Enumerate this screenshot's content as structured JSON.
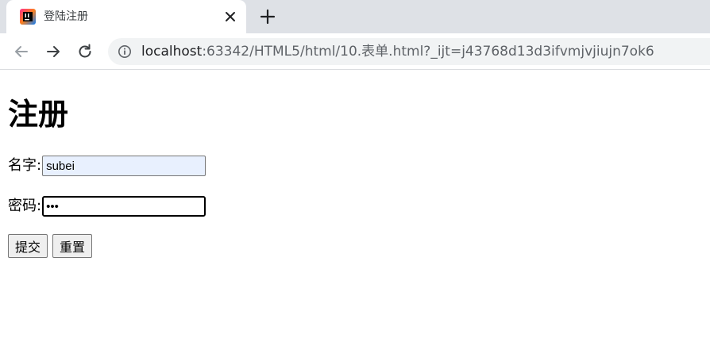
{
  "browser": {
    "tab": {
      "title": "登陆注册",
      "favicon": "jetbrains-favicon-icon"
    },
    "new_tab_icon": "plus-icon",
    "address": {
      "host": "localhost",
      "rest": ":63342/HTML5/html/10.表单.html?_ijt=j43768d13d3ifvmjvjiujn7ok6"
    },
    "nav_icons": [
      "arrow-left-icon",
      "arrow-right-icon",
      "reload-icon",
      "info-icon"
    ]
  },
  "page": {
    "title": "注册",
    "form": {
      "name_label": "名字:",
      "name_value": "subei",
      "password_label": "密码:",
      "password_value": "•••",
      "submit_label": "提交",
      "reset_label": "重置"
    }
  },
  "colors": {
    "tabstrip": "#dee1e6",
    "omnibox": "#f1f3f4",
    "autofill": "#e8f0fe"
  }
}
